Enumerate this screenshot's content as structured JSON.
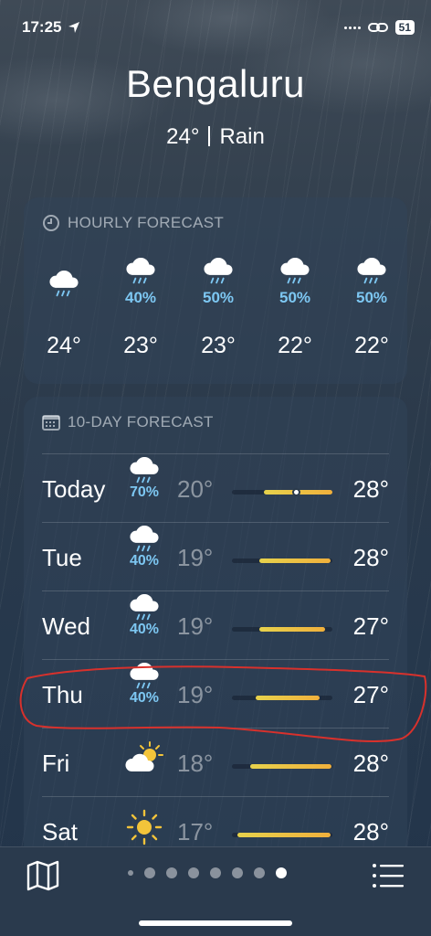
{
  "status_bar": {
    "time": "17:25",
    "battery": "51"
  },
  "location": {
    "city": "Bengaluru",
    "temperature": "24°",
    "condition": "Rain"
  },
  "hourly": {
    "title": "HOURLY FORECAST",
    "items": [
      {
        "precip": "",
        "temp": "24°",
        "icon": "cloud-rain-icon"
      },
      {
        "precip": "40%",
        "temp": "23°",
        "icon": "cloud-rain-icon"
      },
      {
        "precip": "50%",
        "temp": "23°",
        "icon": "cloud-rain-icon"
      },
      {
        "precip": "50%",
        "temp": "22°",
        "icon": "cloud-rain-icon"
      },
      {
        "precip": "50%",
        "temp": "22°",
        "icon": "cloud-rain-icon"
      }
    ]
  },
  "daily": {
    "title": "10-DAY FORECAST",
    "items": [
      {
        "day": "Today",
        "precip": "70%",
        "low": "20°",
        "high": "28°",
        "icon": "cloud-rain-icon"
      },
      {
        "day": "Tue",
        "precip": "40%",
        "low": "19°",
        "high": "28°",
        "icon": "cloud-rain-icon"
      },
      {
        "day": "Wed",
        "precip": "40%",
        "low": "19°",
        "high": "27°",
        "icon": "cloud-rain-icon"
      },
      {
        "day": "Thu",
        "precip": "40%",
        "low": "19°",
        "high": "27°",
        "icon": "cloud-rain-icon"
      },
      {
        "day": "Fri",
        "precip": "",
        "low": "18°",
        "high": "28°",
        "icon": "partly-sunny-icon"
      },
      {
        "day": "Sat",
        "precip": "",
        "low": "17°",
        "high": "28°",
        "icon": "sun-icon"
      }
    ]
  },
  "colors": {
    "precip": "#7dc7f2",
    "annotation": "#d8312c",
    "bar_start": "#e7d24c",
    "bar_end": "#f0b03c"
  },
  "pager": {
    "page_count": 8,
    "active_page": 8
  }
}
